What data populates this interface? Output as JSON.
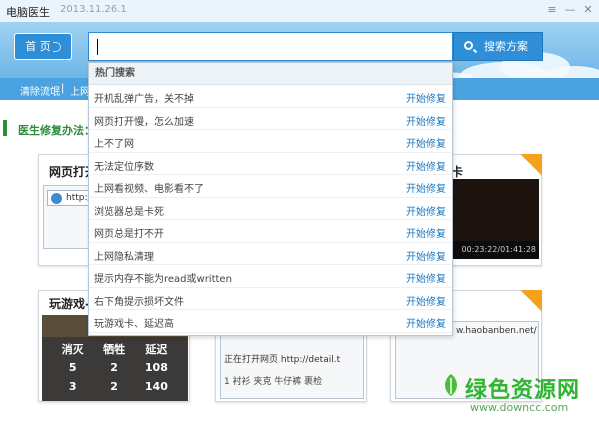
{
  "window": {
    "app_name": "电脑医生",
    "version": "2013.11.26.1",
    "menu_glyph": "≡",
    "min_glyph": "—",
    "close_glyph": "✕"
  },
  "header": {
    "home_label": "首 页",
    "search_value": "",
    "search_button_label": "搜索方案"
  },
  "subnav": {
    "items": [
      "清除流氓",
      "上网"
    ],
    "separator": "|"
  },
  "main": {
    "section_title": "医生修复办法："
  },
  "cards": [
    {
      "title": "网页打开",
      "url_fragment": "http:/"
    },
    {
      "title": "卡",
      "time_label": "00:23:22/01:41:28"
    },
    {
      "title": "玩游戏-卡",
      "banner": "胜利",
      "table": {
        "headers": [
          "消灭",
          "牺牲",
          "延迟"
        ],
        "rows": [
          [
            "5",
            "2",
            "108"
          ],
          [
            "3",
            "2",
            "140"
          ]
        ]
      }
    },
    {
      "title": "",
      "line1": "正在打开网页 http://detail.t",
      "line2": "1 衬衫 夹克 牛仔裤 裹检"
    },
    {
      "title": "",
      "url_fragment": "w.haobanben.net/"
    }
  ],
  "dropdown": {
    "header": "热门搜索",
    "action_label": "开始修复",
    "items": [
      "开机乱弹广告，关不掉",
      "网页打开慢，怎么加速",
      "上不了网",
      "无法定位序数",
      "上网看视频、电影看不了",
      "浏览器总是卡死",
      "网页总是打不开",
      "上网隐私清理",
      "提示内存不能为read或written",
      "右下角提示损坏文件",
      "玩游戏卡、延迟高"
    ]
  },
  "watermark": {
    "main": "绿色资源网",
    "url": "www.downcc.com"
  }
}
